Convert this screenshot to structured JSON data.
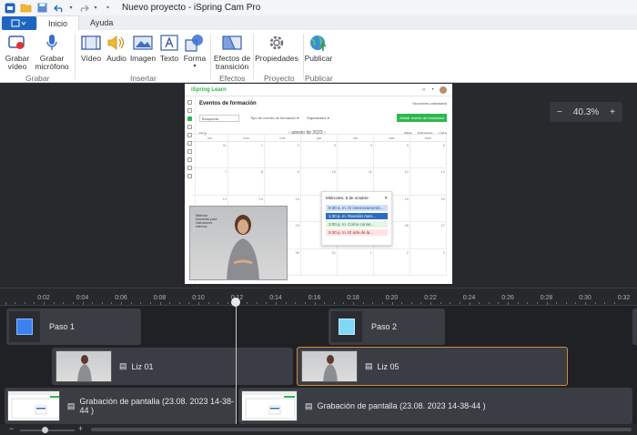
{
  "window": {
    "title": "Nuevo proyecto - iSpring Cam Pro"
  },
  "quick_access": [
    "app-logo-icon",
    "open-folder-icon",
    "save-icon",
    "undo-icon",
    "redo-icon",
    "customize-icon"
  ],
  "ribbon": {
    "tabs": [
      {
        "label": "Inicio",
        "active": true
      },
      {
        "label": "Ayuda",
        "active": false
      }
    ],
    "buttons": {
      "grabar_video": "Grabar\nvídeo",
      "grabar_microfono": "Grabar\nmicrófono",
      "video": "Vídeo",
      "audio": "Audio",
      "imagen": "Imagen",
      "texto": "Texto",
      "forma": "Forma",
      "efectos": "Efectos de\ntransición",
      "propiedades": "Propiedades",
      "publicar": "Publicar"
    },
    "groups": {
      "grabar": "Grabar",
      "insertar": "Insertar",
      "efectos": "Efectos",
      "proyecto": "Proyecto",
      "publicar": "Publicar"
    }
  },
  "zoom": {
    "minus": "−",
    "value": "40.3%",
    "plus": "+"
  },
  "slide": {
    "brand": "iSpring Learn",
    "heading": "Eventos de formación",
    "top_right": "Secciones calendario",
    "search_placeholder": "Búsqueda",
    "filter1": "Tipo de evento de formación ▾",
    "filter2": "Organizador ▾",
    "add_button": "Añadir evento de formación",
    "today": "Hoy",
    "month": "agosto de 2023",
    "views": [
      "Mes",
      "Semana",
      "Lista"
    ],
    "weekdays": [
      "lun",
      "mar",
      "mié",
      "jue",
      "vie",
      "sáb",
      "dom"
    ],
    "day_numbers": [
      "31",
      "1",
      "2",
      "3",
      "4",
      "5",
      "6",
      "7",
      "8",
      "9",
      "10",
      "11",
      "12",
      "13",
      "14",
      "15",
      "16",
      "17",
      "18",
      "19",
      "20",
      "21",
      "22",
      "23",
      "24",
      "25",
      "26",
      "27",
      "28",
      "29",
      "30",
      "31",
      "1",
      "2",
      "3"
    ],
    "popup": {
      "title": "Miércoles, 6 de octubre",
      "events": [
        "9:30 a. m. iS intensivamente...",
        "1:30 p. m. Reunión men...",
        "3:00 p. m. Cómo conse...",
        "9:30 p. m. El arte de la..."
      ]
    },
    "video_caption": "Webinar formación para instructores internos"
  },
  "timeline": {
    "ticks": [
      "0:02",
      "0:04",
      "0:06",
      "0:08",
      "0:10",
      "0:12",
      "0:14",
      "0:16",
      "0:18",
      "0:20",
      "0:22",
      "0:24",
      "0:26",
      "0:28",
      "0:30",
      "0:32"
    ],
    "tracks": {
      "paso1": "Paso 1",
      "paso2": "Paso 2",
      "liz01": "Liz 01",
      "liz05": "Liz 05",
      "screen1": "Grabación de pantalla (23.08. 2023 14-38-44 )",
      "screen2": "Grabación de pantalla (23.08. 2023 14-38-44 )"
    },
    "zoom_minus": "−",
    "zoom_plus": "+"
  },
  "colors": {
    "accent": "#1d65c1",
    "slide_paso1": "#3b82f0",
    "slide_paso2": "#7fd8f5",
    "selected_clip": "#d28a3c",
    "calendar_green": "#2db84d"
  }
}
